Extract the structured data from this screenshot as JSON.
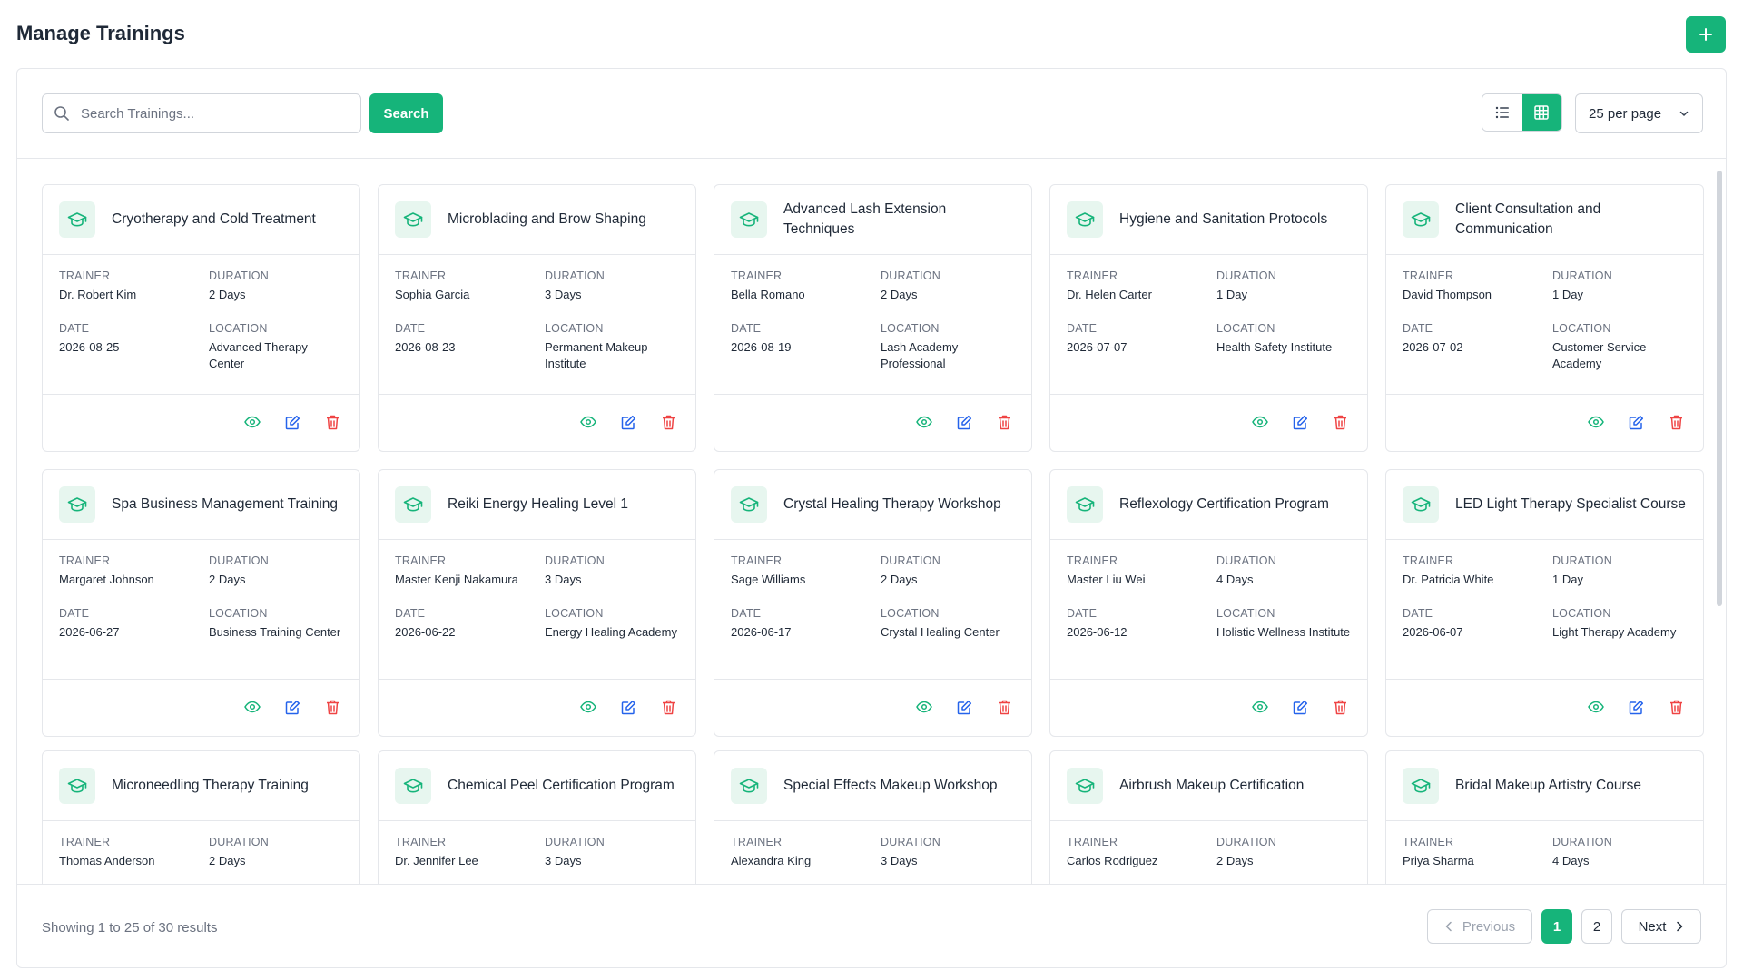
{
  "header": {
    "title": "Manage Trainings",
    "add_icon": "plus-icon"
  },
  "toolbar": {
    "search_placeholder": "Search Trainings...",
    "search_label": "Search",
    "per_page": "25 per page",
    "view_mode": "grid"
  },
  "labels": {
    "trainer": "TRAINER",
    "duration": "DURATION",
    "date": "DATE",
    "location": "LOCATION"
  },
  "colors": {
    "accent": "#16b47a",
    "view": "#16b47a",
    "edit": "#2563eb",
    "delete": "#ef4444"
  },
  "trainings": [
    {
      "title": "Cryotherapy and Cold Treatment",
      "trainer": "Dr. Robert Kim",
      "duration": "2 Days",
      "date": "2026-08-25",
      "location": "Advanced Therapy Center"
    },
    {
      "title": "Microblading and Brow Shaping",
      "trainer": "Sophia Garcia",
      "duration": "3 Days",
      "date": "2026-08-23",
      "location": "Permanent Makeup Institute"
    },
    {
      "title": "Advanced Lash Extension Techniques",
      "trainer": "Bella Romano",
      "duration": "2 Days",
      "date": "2026-08-19",
      "location": "Lash Academy Professional"
    },
    {
      "title": "Hygiene and Sanitation Protocols",
      "trainer": "Dr. Helen Carter",
      "duration": "1 Day",
      "date": "2026-07-07",
      "location": "Health Safety Institute"
    },
    {
      "title": "Client Consultation and Communication",
      "trainer": "David Thompson",
      "duration": "1 Day",
      "date": "2026-07-02",
      "location": "Customer Service Academy"
    },
    {
      "title": "Spa Business Management Training",
      "trainer": "Margaret Johnson",
      "duration": "2 Days",
      "date": "2026-06-27",
      "location": "Business Training Center"
    },
    {
      "title": "Reiki Energy Healing Level 1",
      "trainer": "Master Kenji Nakamura",
      "duration": "3 Days",
      "date": "2026-06-22",
      "location": "Energy Healing Academy"
    },
    {
      "title": "Crystal Healing Therapy Workshop",
      "trainer": "Sage Williams",
      "duration": "2 Days",
      "date": "2026-06-17",
      "location": "Crystal Healing Center"
    },
    {
      "title": "Reflexology Certification Program",
      "trainer": "Master Liu Wei",
      "duration": "4 Days",
      "date": "2026-06-12",
      "location": "Holistic Wellness Institute"
    },
    {
      "title": "LED Light Therapy Specialist Course",
      "trainer": "Dr. Patricia White",
      "duration": "1 Day",
      "date": "2026-06-07",
      "location": "Light Therapy Academy"
    },
    {
      "title": "Microneedling Therapy Training",
      "trainer": "Thomas Anderson",
      "duration": "2 Days",
      "date": "",
      "location": ""
    },
    {
      "title": "Chemical Peel Certification Program",
      "trainer": "Dr. Jennifer Lee",
      "duration": "3 Days",
      "date": "",
      "location": ""
    },
    {
      "title": "Special Effects Makeup Workshop",
      "trainer": "Alexandra King",
      "duration": "3 Days",
      "date": "",
      "location": ""
    },
    {
      "title": "Airbrush Makeup Certification",
      "trainer": "Carlos Rodriguez",
      "duration": "2 Days",
      "date": "",
      "location": ""
    },
    {
      "title": "Bridal Makeup Artistry Course",
      "trainer": "Priya Sharma",
      "duration": "4 Days",
      "date": "",
      "location": ""
    }
  ],
  "footer": {
    "showing": "Showing 1 to 25 of 30 results",
    "previous": "Previous",
    "next": "Next",
    "pages": [
      "1",
      "2"
    ],
    "current_page": "1"
  }
}
